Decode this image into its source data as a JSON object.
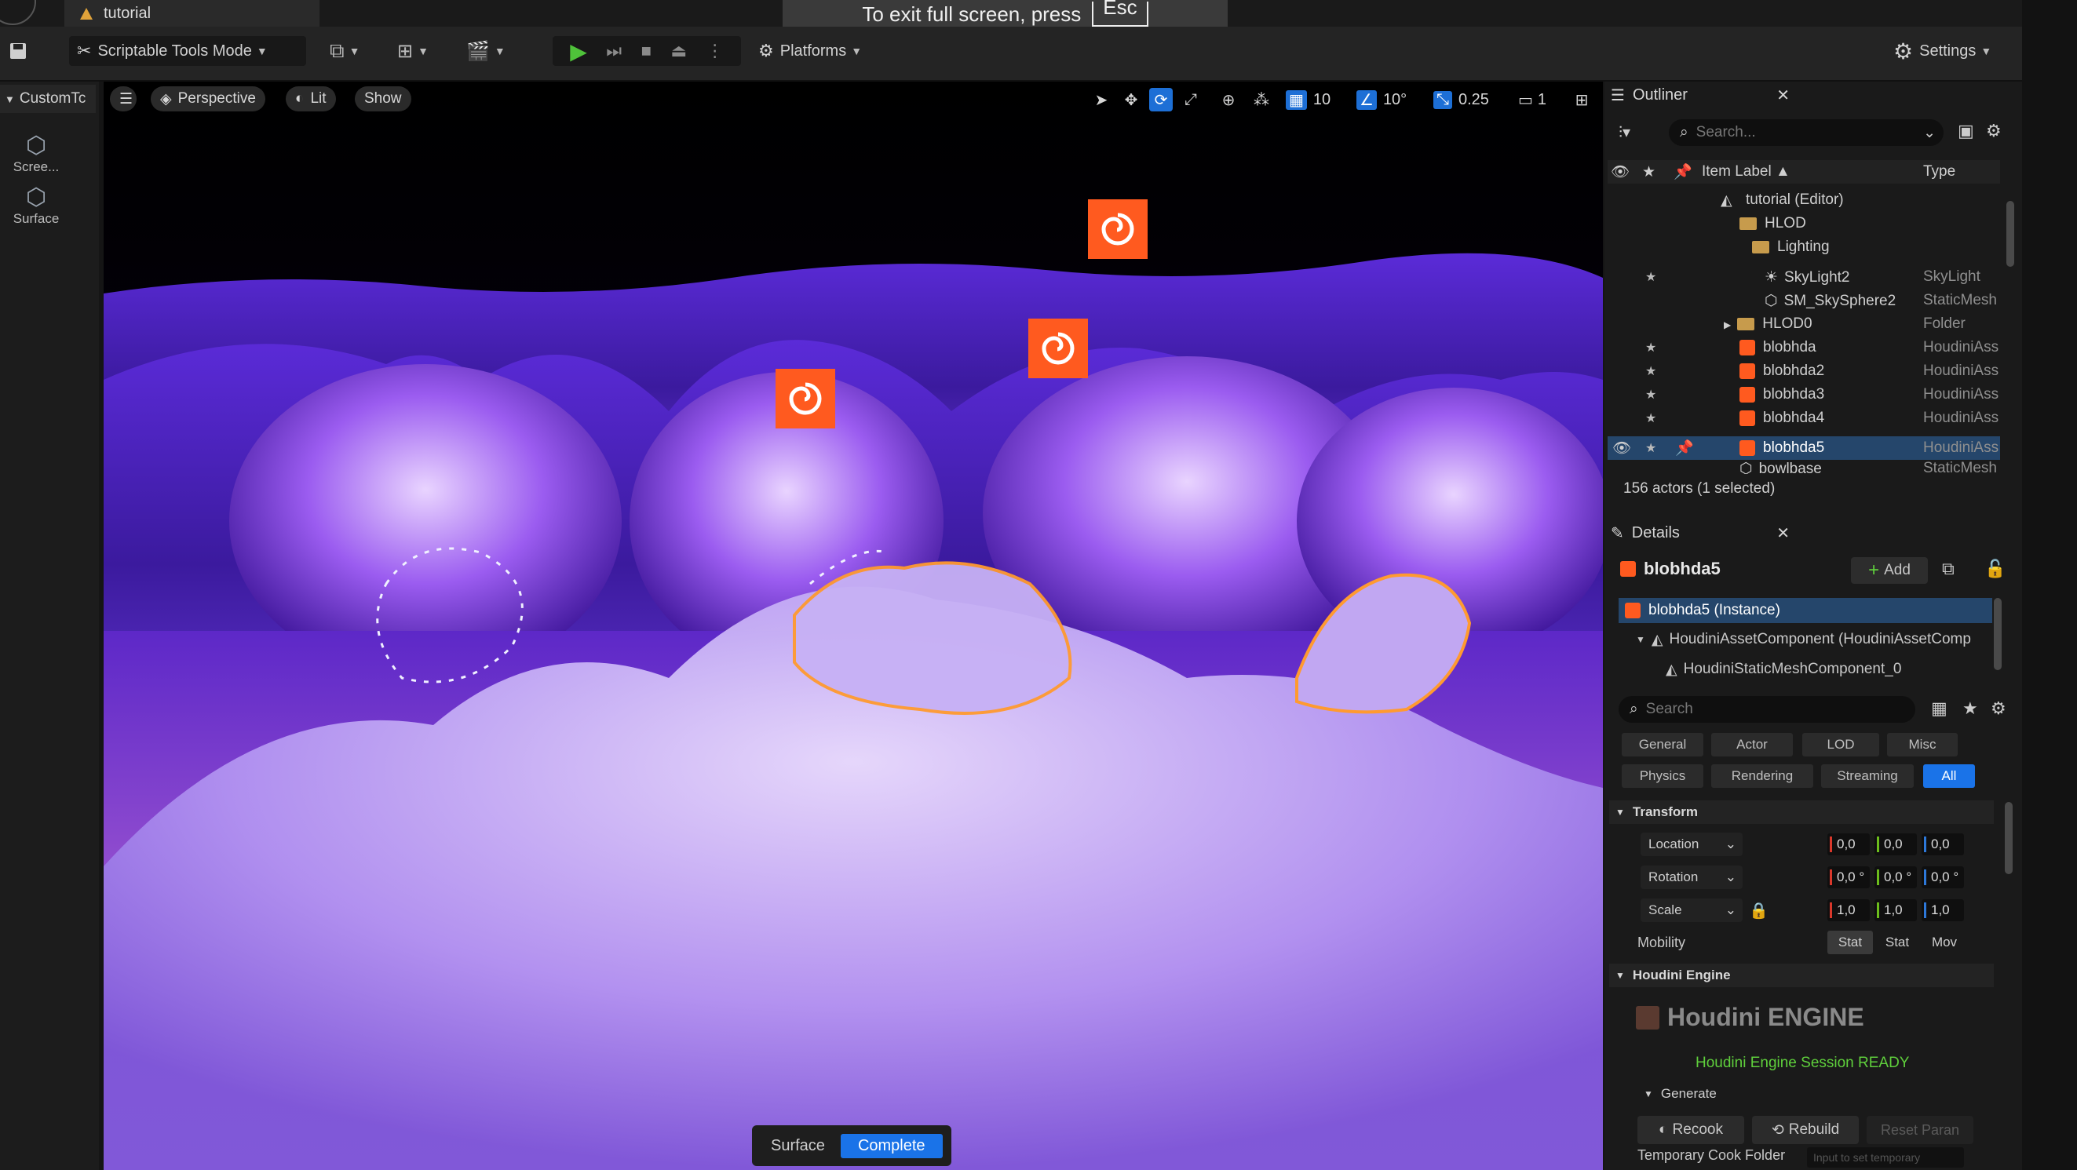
{
  "title_bar": {
    "project_tab": "tutorial"
  },
  "fullscreen_toast": {
    "text": "To exit full screen, press",
    "key": "Esc"
  },
  "toolbar": {
    "mode_label": "Scriptable Tools Mode",
    "platforms_label": "Platforms",
    "settings_label": "Settings"
  },
  "left_panel": {
    "tab_label": "CustomTc",
    "buttons": [
      {
        "label": "Scree..."
      },
      {
        "label": "Surface"
      }
    ]
  },
  "viewport": {
    "perspective_label": "Perspective",
    "lit_label": "Lit",
    "show_label": "Show",
    "grid_snap": "10",
    "rotation_snap": "10°",
    "scale_snap": "0.25",
    "camera_speed": "1",
    "mode_bar": {
      "surface_label": "Surface",
      "complete_label": "Complete"
    }
  },
  "outliner": {
    "tab_label": "Outliner",
    "search_placeholder": "Search...",
    "col_label": "Item Label ▲",
    "col_type": "Type",
    "items": [
      {
        "label": "tutorial (Editor)",
        "type": ""
      },
      {
        "label": "HLOD",
        "type": ""
      },
      {
        "label": "Lighting",
        "type": ""
      },
      {
        "label": "SkyLight2",
        "type": "SkyLight"
      },
      {
        "label": "SM_SkySphere2",
        "type": "StaticMesh"
      },
      {
        "label": "HLOD0",
        "type": "Folder"
      },
      {
        "label": "blobhda",
        "type": "HoudiniAss"
      },
      {
        "label": "blobhda2",
        "type": "HoudiniAss"
      },
      {
        "label": "blobhda3",
        "type": "HoudiniAss"
      },
      {
        "label": "blobhda4",
        "type": "HoudiniAss"
      },
      {
        "label": "blobhda5",
        "type": "HoudiniAss"
      },
      {
        "label": "bowlbase",
        "type": "StaticMesh"
      }
    ],
    "status": "156 actors (1 selected)"
  },
  "details": {
    "tab_label": "Details",
    "actor_name": "blobhda5",
    "add_label": "Add",
    "components": [
      "blobhda5 (Instance)",
      "HoudiniAssetComponent (HoudiniAssetComp",
      "HoudiniStaticMeshComponent_0"
    ],
    "search_placeholder": "Search",
    "categories": [
      "General",
      "Actor",
      "LOD",
      "Misc",
      "Physics",
      "Rendering",
      "Streaming",
      "All"
    ],
    "transform_section": "Transform",
    "location_label": "Location",
    "rotation_label": "Rotation",
    "scale_label": "Scale",
    "location": [
      "0,0",
      "0,0",
      "0,0"
    ],
    "rotation": [
      "0,0 °",
      "0,0 °",
      "0,0 °"
    ],
    "scale": [
      "1,0",
      "1,0",
      "1,0"
    ],
    "mobility_label": "Mobility",
    "mobility_options": [
      "Stat",
      "Stat",
      "Mov"
    ],
    "houdini_section": "Houdini Engine",
    "houdini_logo_text": "Houdini ENGINE",
    "session_status": "Houdini Engine Session READY",
    "generate_label": "Generate",
    "recook_label": "Recook",
    "rebuild_label": "Rebuild",
    "reset_label": "Reset Paran",
    "temp_cook_label": "Temporary Cook Folder",
    "temp_cook_placeholder": "Input to set temporary"
  },
  "colors": {
    "accent": "#1a73e8",
    "houdini": "#ff5a1f",
    "ready": "#5fcf3c"
  }
}
